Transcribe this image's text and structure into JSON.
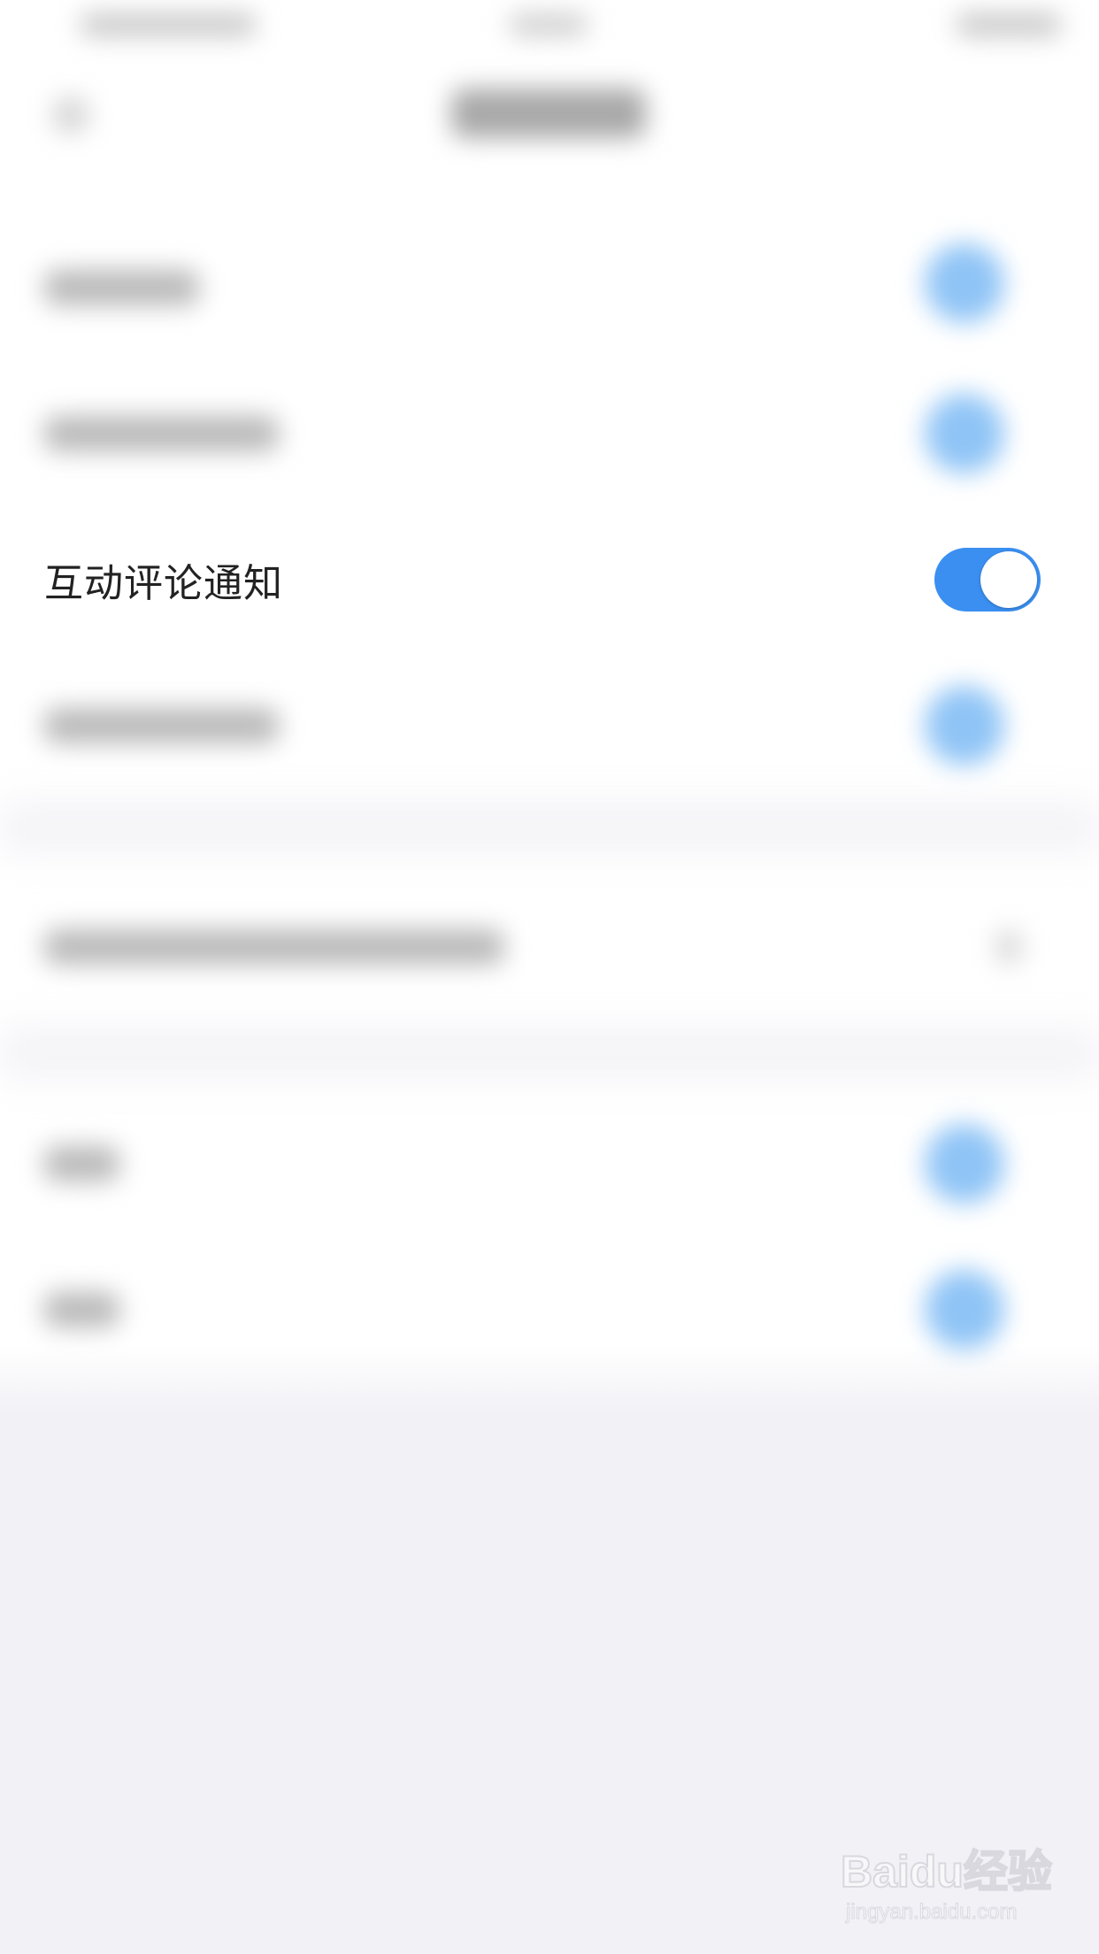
{
  "settings": {
    "rows": [
      {
        "label": "互动评论通知",
        "toggle_on": true
      }
    ]
  },
  "colors": {
    "toggle_on": "#3a8ff1",
    "page_background": "#f1f1f6",
    "sheet_background": "#ffffff",
    "label_text": "#222222"
  },
  "watermark": {
    "main": "Baidu经验",
    "sub": "jingyan.baidu.com"
  }
}
